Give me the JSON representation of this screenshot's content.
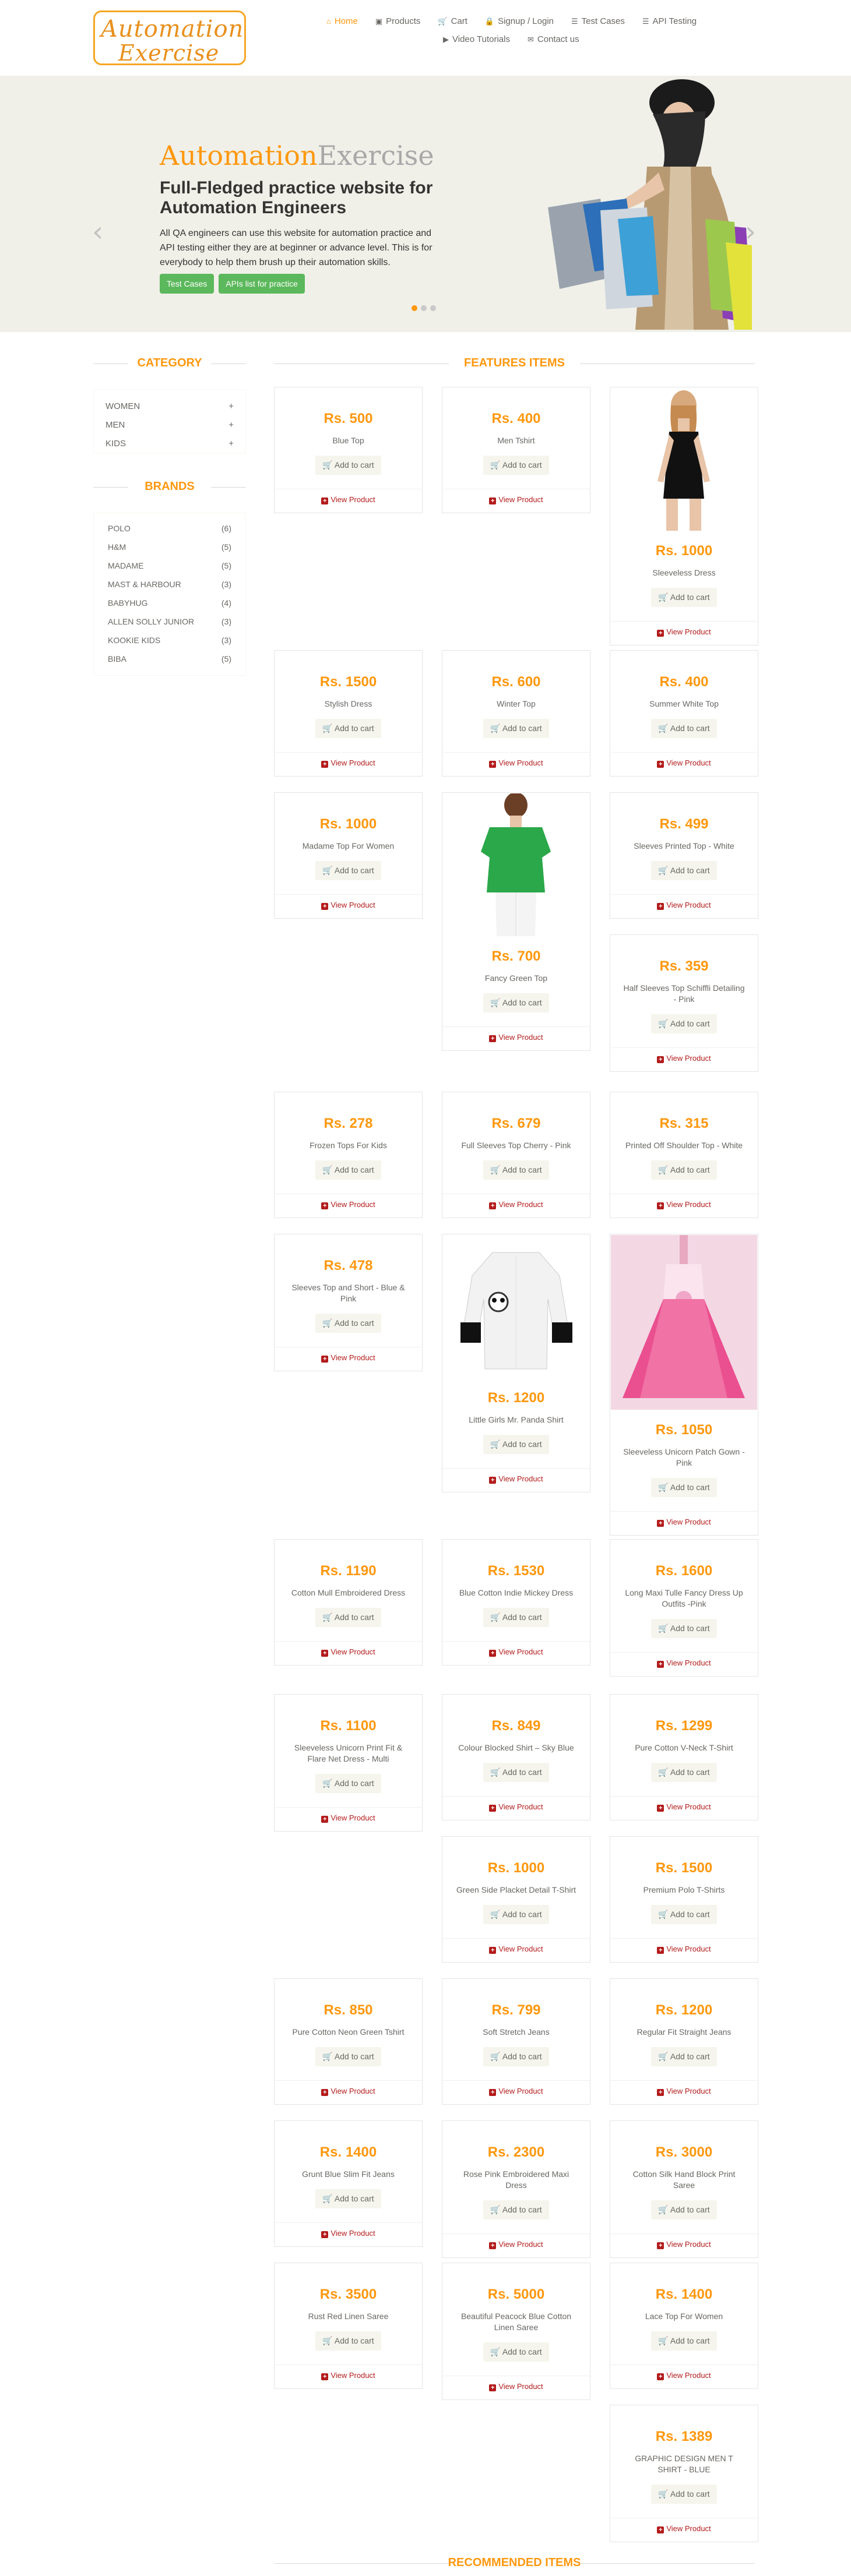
{
  "logo": {
    "line1": "Automation",
    "line2": "Exercise"
  },
  "nav": {
    "row1": [
      {
        "label": "Home",
        "icon": "home-icon",
        "glyph": "⌂",
        "active": true
      },
      {
        "label": "Products",
        "icon": "products-icon",
        "glyph": "▣"
      },
      {
        "label": "Cart",
        "icon": "cart-icon",
        "glyph": "🛒"
      },
      {
        "label": "Signup / Login",
        "icon": "lock-icon",
        "glyph": "🔒"
      },
      {
        "label": "Test Cases",
        "icon": "list-icon",
        "glyph": "☰"
      },
      {
        "label": "API Testing",
        "icon": "list-icon",
        "glyph": "☰"
      }
    ],
    "row2": [
      {
        "label": "Video Tutorials",
        "icon": "youtube-icon",
        "glyph": "▶"
      },
      {
        "label": "Contact us",
        "icon": "envelope-icon",
        "glyph": "✉"
      }
    ]
  },
  "slider": {
    "brand_a": "Automation",
    "brand_b": "Exercise",
    "title": "Full-Fledged practice website for Automation Engineers",
    "description": "All QA engineers can use this website for automation practice and API testing either they are at beginner or advance level. This is for everybody to help them brush up their automation skills.",
    "test_cases_label": "Test Cases",
    "apis_label": "APIs list for practice",
    "prev": "‹",
    "next": "›"
  },
  "sidebar": {
    "category_title": "CATEGORY",
    "categories": [
      {
        "label": "WOMEN",
        "sign": "+"
      },
      {
        "label": "MEN",
        "sign": "+"
      },
      {
        "label": "KIDS",
        "sign": "+"
      }
    ],
    "brands_title": "BRANDS",
    "brands": [
      {
        "name": "POLO",
        "count": "(6)"
      },
      {
        "name": "H&M",
        "count": "(5)"
      },
      {
        "name": "MADAME",
        "count": "(5)"
      },
      {
        "name": "MAST & HARBOUR",
        "count": "(3)"
      },
      {
        "name": "BABYHUG",
        "count": "(4)"
      },
      {
        "name": "ALLEN SOLLY JUNIOR",
        "count": "(3)"
      },
      {
        "name": "KOOKIE KIDS",
        "count": "(3)"
      },
      {
        "name": "BIBA",
        "count": "(5)"
      }
    ]
  },
  "features_title": "FEATURES ITEMS",
  "recommended_title": "RECOMMENDED ITEMS",
  "add_to_cart": "Add to cart",
  "view_product": "View Product",
  "products": [
    {
      "price": "Rs. 500",
      "name": "Blue Top"
    },
    {
      "price": "Rs. 400",
      "name": "Men Tshirt"
    },
    {
      "price": "Rs. 1000",
      "name": "Sleeveless Dress"
    },
    {
      "price": "Rs. 1500",
      "name": "Stylish Dress"
    },
    {
      "price": "Rs. 600",
      "name": "Winter Top"
    },
    {
      "price": "Rs. 400",
      "name": "Summer White Top"
    },
    {
      "price": "Rs. 1000",
      "name": "Madame Top For Women"
    },
    {
      "price": "Rs. 700",
      "name": "Fancy Green Top"
    },
    {
      "price": "Rs. 499",
      "name": "Sleeves Printed Top - White"
    },
    {
      "price": "Rs. 359",
      "name": "Half Sleeves Top Schiffli Detailing - Pink"
    },
    {
      "price": "Rs. 278",
      "name": "Frozen Tops For Kids"
    },
    {
      "price": "Rs. 679",
      "name": "Full Sleeves Top Cherry - Pink"
    },
    {
      "price": "Rs. 315",
      "name": "Printed Off Shoulder Top - White"
    },
    {
      "price": "Rs. 478",
      "name": "Sleeves Top and Short - Blue & Pink"
    },
    {
      "price": "Rs. 1200",
      "name": "Little Girls Mr. Panda Shirt"
    },
    {
      "price": "Rs. 1050",
      "name": "Sleeveless Unicorn Patch Gown - Pink"
    },
    {
      "price": "Rs. 1190",
      "name": "Cotton Mull Embroidered Dress"
    },
    {
      "price": "Rs. 1530",
      "name": "Blue Cotton Indie Mickey Dress"
    },
    {
      "price": "Rs. 1600",
      "name": "Long Maxi Tulle Fancy Dress Up Outfits -Pink"
    },
    {
      "price": "Rs. 1100",
      "name": "Sleeveless Unicorn Print Fit & Flare Net Dress - Multi"
    },
    {
      "price": "Rs. 849",
      "name": "Colour Blocked Shirt – Sky Blue"
    },
    {
      "price": "Rs. 1299",
      "name": "Pure Cotton V-Neck T-Shirt"
    },
    {
      "price": "Rs. 1000",
      "name": "Green Side Placket Detail T-Shirt"
    },
    {
      "price": "Rs. 1500",
      "name": "Premium Polo T-Shirts"
    },
    {
      "price": "Rs. 850",
      "name": "Pure Cotton Neon Green Tshirt"
    },
    {
      "price": "Rs. 799",
      "name": "Soft Stretch Jeans"
    },
    {
      "price": "Rs. 1200",
      "name": "Regular Fit Straight Jeans"
    },
    {
      "price": "Rs. 1400",
      "name": "Grunt Blue Slim Fit Jeans"
    },
    {
      "price": "Rs. 2300",
      "name": "Rose Pink Embroidered Maxi Dress"
    },
    {
      "price": "Rs. 3000",
      "name": "Cotton Silk Hand Block Print Saree"
    },
    {
      "price": "Rs. 3500",
      "name": "Rust Red Linen Saree"
    },
    {
      "price": "Rs. 5000",
      "name": "Beautiful Peacock Blue Cotton Linen Saree"
    },
    {
      "price": "Rs. 1400",
      "name": "Lace Top For Women"
    },
    {
      "price": "Rs. 1389",
      "name": "GRAPHIC DESIGN MEN T SHIRT - BLUE"
    }
  ],
  "colors": {
    "accent": "#fe980f",
    "green": "#5cb85c",
    "view": "#b31b1b"
  }
}
